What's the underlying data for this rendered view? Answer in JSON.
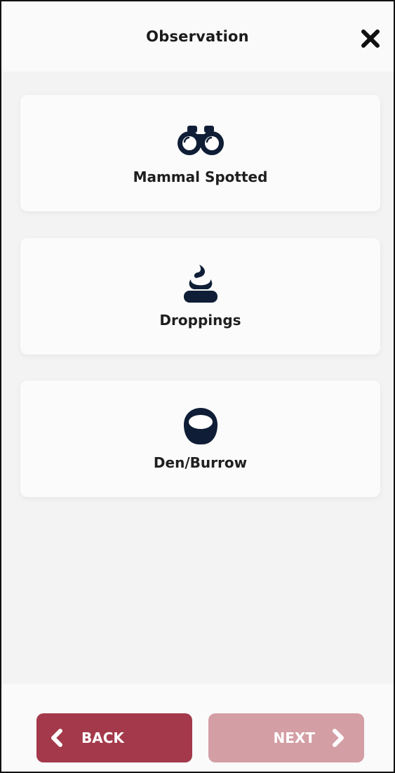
{
  "header": {
    "title": "Observation",
    "close_icon": "close-icon"
  },
  "options": [
    {
      "label": "Mammal Spotted",
      "icon": "binoculars-icon"
    },
    {
      "label": "Droppings",
      "icon": "droppings-icon"
    },
    {
      "label": "Den/Burrow",
      "icon": "burrow-icon"
    }
  ],
  "footer": {
    "back_label": "BACK",
    "next_label": "NEXT"
  },
  "colors": {
    "icon": "#0f1e36",
    "back_button": "#a3394a",
    "next_button_disabled": "#d49ea5"
  }
}
